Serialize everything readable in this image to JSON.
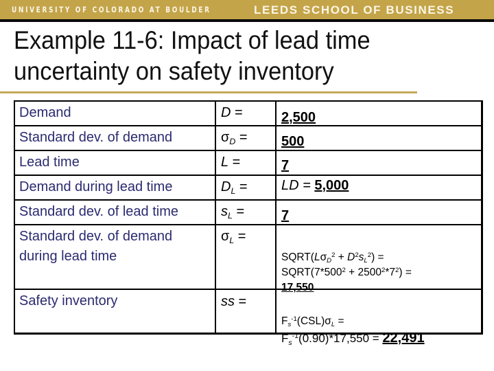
{
  "header": {
    "university": "UNIVERSITY OF COLORADO AT BOULDER",
    "school": "LEEDS SCHOOL OF BUSINESS",
    "brand_color": "#C4A449"
  },
  "slide": {
    "title_line1": "Example 11-6: Impact of lead time",
    "title_line2": "uncertainty on safety inventory"
  },
  "table": {
    "rows": [
      {
        "label": "Demand",
        "symbol": "D",
        "symbol_sub": "",
        "equals": " =",
        "value": "2,500"
      },
      {
        "label": "Standard dev. of demand",
        "symbol": "σ",
        "symbol_sub": "D",
        "equals": " =",
        "value": "500"
      },
      {
        "label": "Lead time",
        "symbol": "L",
        "symbol_sub": "",
        "equals": " =",
        "value": "7"
      },
      {
        "label": "Demand during lead time",
        "symbol": "D",
        "symbol_sub": "L",
        "equals": " =",
        "value_prefix": "LD = ",
        "value": "5,000"
      },
      {
        "label": "Standard dev. of lead time",
        "symbol": "s",
        "symbol_sub": "L",
        "equals": " =",
        "value": "7"
      },
      {
        "label_line1": "Standard dev. of demand",
        "label_line2": "during lead time",
        "symbol": "σ",
        "symbol_sub": "L",
        "equals": " =",
        "formula_line1": "SQRT(Lσ_D^2 + D^2 s_L^2) =",
        "formula_line2": "SQRT(7*500^2 + 2500^2*7^2) =",
        "value": "17,550"
      },
      {
        "label": "Safety inventory",
        "symbol": "ss",
        "symbol_sub": "",
        "equals": " =",
        "formula_line1": "F_s^-1(CSL)σ_L =",
        "formula_line2_prefix": "F_s^-1(0.90)*17,550 = ",
        "value": "22,491"
      }
    ],
    "parts": {
      "sqrt": "SQRT(",
      "plus": " + ",
      "close_eq": ") =",
      "two": "2",
      "neg1": "-1",
      "csl": "(CSL)",
      "p90": "(0.90)*17,550 = ",
      "f": "F",
      "s": "s",
      "sigma": "σ",
      "L": "L",
      "D": "D",
      "eq": " =",
      "n7": "7",
      "n500": "500",
      "n2500": "2500",
      "star": "*"
    }
  }
}
